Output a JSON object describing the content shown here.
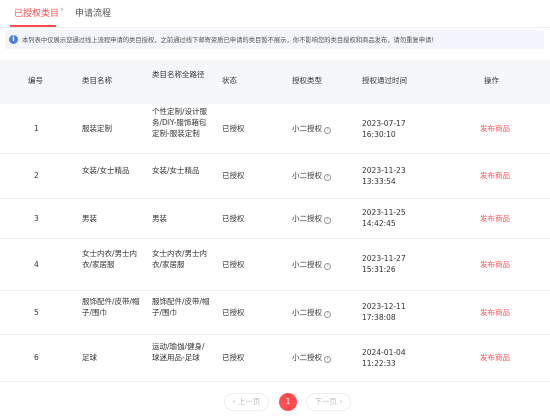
{
  "tabs": {
    "active": "已授权类目",
    "separator": "›",
    "other": "申请流程"
  },
  "notice": {
    "icon": "info-icon",
    "text": "本列表中仅展示您通过线上流程申请的类目授权，之前通过线下邮寄资质已申请的类目暂不展示，你不影响您的类目授权和商品发布，请勿重复申请!"
  },
  "table": {
    "headers": {
      "no": "编号",
      "name": "类目名称",
      "path": "类目名称全路径",
      "status": "状态",
      "auth_type": "授权类型",
      "time": "授权通过时间",
      "action": "操作"
    },
    "rows": [
      {
        "no": "1",
        "name": "服装定制",
        "path": "个性定制/设计服务/DIY-服饰箱包定制-服装定制",
        "status": "已授权",
        "auth_type": "小二授权",
        "time": "2023-07-17 16:30:10",
        "action": "发布商品"
      },
      {
        "no": "2",
        "name": "女装/女士精品",
        "path": "女装/女士精品",
        "status": "已授权",
        "auth_type": "小二授权",
        "time": "2023-11-23 13:33:54",
        "action": "发布商品"
      },
      {
        "no": "3",
        "name": "男装",
        "path": "男装",
        "status": "已授权",
        "auth_type": "小二授权",
        "time": "2023-11-25 14:42:45",
        "action": "发布商品"
      },
      {
        "no": "4",
        "name": "女士内衣/男士内衣/家居服",
        "path": "女士内衣/男士内衣/家居服",
        "status": "已授权",
        "auth_type": "小二授权",
        "time": "2023-11-27 15:31:26",
        "action": "发布商品"
      },
      {
        "no": "5",
        "name": "服饰配件/皮带/帽子/围巾",
        "path": "服饰配件/皮带/帽子/围巾",
        "status": "已授权",
        "auth_type": "小二授权",
        "time": "2023-12-11 17:38:08",
        "action": "发布商品"
      },
      {
        "no": "6",
        "name": "足球",
        "path": "运动/瑜伽/健身/球迷用品-足球",
        "status": "已授权",
        "auth_type": "小二授权",
        "time": "2024-01-04 11:22:33",
        "action": "发布商品"
      }
    ]
  },
  "pagination": {
    "prev": "‹ 上一页",
    "current": "1",
    "next": "下一页 ›"
  },
  "colors": {
    "accent": "#ff4d4f",
    "notice_bg": "#f2f5fb",
    "header_bg": "#f6f7f9"
  }
}
